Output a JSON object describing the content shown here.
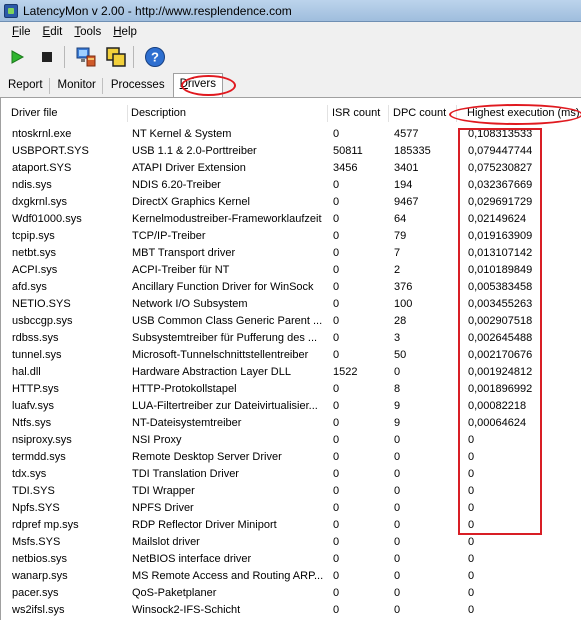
{
  "window": {
    "title": "LatencyMon v 2.00 - http://www.resplendence.com"
  },
  "menu": [
    {
      "u": "F",
      "rest": "ile"
    },
    {
      "u": "E",
      "rest": "dit"
    },
    {
      "u": "T",
      "rest": "ools"
    },
    {
      "u": "H",
      "rest": "elp"
    }
  ],
  "tabs": {
    "report": "Report",
    "monitor": "Monitor",
    "processes": "Processes",
    "drivers_u": "D",
    "drivers_rest": "rivers"
  },
  "columns": {
    "file": "Driver file",
    "desc": "Description",
    "isr": "ISR count",
    "dpc": "DPC count",
    "high": "Highest execution (ms)"
  },
  "rows": [
    {
      "file": "ntoskrnl.exe",
      "desc": "NT Kernel & System",
      "isr": "0",
      "dpc": "4577",
      "high": "0,108313533"
    },
    {
      "file": "USBPORT.SYS",
      "desc": "USB 1.1 & 2.0-Porttreiber",
      "isr": "50811",
      "dpc": "185335",
      "high": "0,079447744"
    },
    {
      "file": "ataport.SYS",
      "desc": "ATAPI Driver Extension",
      "isr": "3456",
      "dpc": "3401",
      "high": "0,075230827"
    },
    {
      "file": "ndis.sys",
      "desc": "NDIS 6.20-Treiber",
      "isr": "0",
      "dpc": "194",
      "high": "0,032367669"
    },
    {
      "file": "dxgkrnl.sys",
      "desc": "DirectX Graphics Kernel",
      "isr": "0",
      "dpc": "9467",
      "high": "0,029691729"
    },
    {
      "file": "Wdf01000.sys",
      "desc": "Kernelmodustreiber-Frameworklaufzeit",
      "isr": "0",
      "dpc": "64",
      "high": "0,02149624"
    },
    {
      "file": "tcpip.sys",
      "desc": "TCP/IP-Treiber",
      "isr": "0",
      "dpc": "79",
      "high": "0,019163909"
    },
    {
      "file": "netbt.sys",
      "desc": "MBT Transport driver",
      "isr": "0",
      "dpc": "7",
      "high": "0,013107142"
    },
    {
      "file": "ACPI.sys",
      "desc": "ACPI-Treiber für NT",
      "isr": "0",
      "dpc": "2",
      "high": "0,010189849"
    },
    {
      "file": "afd.sys",
      "desc": "Ancillary Function Driver for WinSock",
      "isr": "0",
      "dpc": "376",
      "high": "0,005383458"
    },
    {
      "file": "NETIO.SYS",
      "desc": "Network I/O Subsystem",
      "isr": "0",
      "dpc": "100",
      "high": "0,003455263"
    },
    {
      "file": "usbccgp.sys",
      "desc": "USB Common Class Generic Parent ...",
      "isr": "0",
      "dpc": "28",
      "high": "0,002907518"
    },
    {
      "file": "rdbss.sys",
      "desc": "Subsystemtreiber für Pufferung des ...",
      "isr": "0",
      "dpc": "3",
      "high": "0,002645488"
    },
    {
      "file": "tunnel.sys",
      "desc": "Microsoft-Tunnelschnittstellentreiber",
      "isr": "0",
      "dpc": "50",
      "high": "0,002170676"
    },
    {
      "file": "hal.dll",
      "desc": "Hardware Abstraction Layer DLL",
      "isr": "1522",
      "dpc": "0",
      "high": "0,001924812"
    },
    {
      "file": "HTTP.sys",
      "desc": "HTTP-Protokollstapel",
      "isr": "0",
      "dpc": "8",
      "high": "0,001896992"
    },
    {
      "file": "luafv.sys",
      "desc": "LUA-Filtertreiber zur Dateivirtualisier...",
      "isr": "0",
      "dpc": "9",
      "high": "0,00082218"
    },
    {
      "file": "Ntfs.sys",
      "desc": "NT-Dateisystemtreiber",
      "isr": "0",
      "dpc": "9",
      "high": "0,00064624"
    },
    {
      "file": "nsiproxy.sys",
      "desc": "NSI Proxy",
      "isr": "0",
      "dpc": "0",
      "high": "0"
    },
    {
      "file": "termdd.sys",
      "desc": "Remote Desktop Server Driver",
      "isr": "0",
      "dpc": "0",
      "high": "0"
    },
    {
      "file": "tdx.sys",
      "desc": "TDI Translation Driver",
      "isr": "0",
      "dpc": "0",
      "high": "0"
    },
    {
      "file": "TDI.SYS",
      "desc": "TDI Wrapper",
      "isr": "0",
      "dpc": "0",
      "high": "0"
    },
    {
      "file": "Npfs.SYS",
      "desc": "NPFS Driver",
      "isr": "0",
      "dpc": "0",
      "high": "0"
    },
    {
      "file": "rdpref mp.sys",
      "desc": "RDP Reflector Driver Miniport",
      "isr": "0",
      "dpc": "0",
      "high": "0"
    },
    {
      "file": "Msfs.SYS",
      "desc": "Mailslot driver",
      "isr": "0",
      "dpc": "0",
      "high": "0"
    },
    {
      "file": "netbios.sys",
      "desc": "NetBIOS interface driver",
      "isr": "0",
      "dpc": "0",
      "high": "0"
    },
    {
      "file": "wanarp.sys",
      "desc": "MS Remote Access and Routing ARP...",
      "isr": "0",
      "dpc": "0",
      "high": "0"
    },
    {
      "file": "pacer.sys",
      "desc": "QoS-Paketplaner",
      "isr": "0",
      "dpc": "0",
      "high": "0"
    },
    {
      "file": "ws2ifsl.sys",
      "desc": "Winsock2-IFS-Schicht",
      "isr": "0",
      "dpc": "0",
      "high": "0"
    }
  ],
  "colors": {
    "annotation": "#e0191f"
  },
  "icons": [
    "app-icon",
    "start-icon",
    "stop-icon",
    "computer-icon",
    "windows-icon",
    "help-icon"
  ]
}
